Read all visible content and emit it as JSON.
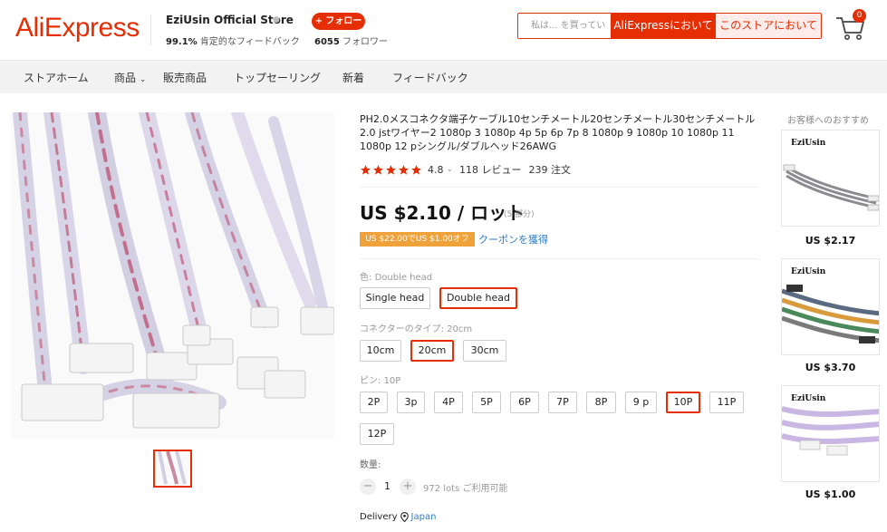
{
  "header": {
    "logo": "AliExpress",
    "store_name": "EziUsin Official Store",
    "store_rating_value": "99.1%",
    "store_rating_text": "肯定的なフィードバック",
    "follow_label": "+ フォロー",
    "followers_count": "6055",
    "followers_label": "フォロワー",
    "search_placeholder": "私は... を買ってい",
    "search_aliexpress": "AliExpressにおいて",
    "search_store": "このストアにおいて",
    "cart_count": "0"
  },
  "nav": {
    "items": [
      "ストアホーム",
      "商品",
      "販売商品",
      "トップセーリング",
      "新着",
      "フィードバック"
    ]
  },
  "product": {
    "title": "PH2.0メスコネクタ端子ケーブル10センチメートル20センチメートル30センチメートル 2.0 jstワイヤー2 1080p 3 1080p 4p 5p 6p 7p 8 1080p 9 1080p 10 1080p 11 1080p 12 pシングル/ダブルヘッド26AWG",
    "rating": "4.8",
    "reviews": "118 レビュー",
    "orders": "239 注文",
    "price": "US $2.10 / ロット",
    "price_sub": "(5 部分)",
    "coupon": "US $22.00でUS $1.00オフ",
    "coupon_link": "クーポンを獲得",
    "color_label": "色:",
    "color_value": "Double head",
    "color_options": [
      "Single head",
      "Double head"
    ],
    "connector_label": "コネクターのタイプ:",
    "connector_value": "20cm",
    "connector_options": [
      "10cm",
      "20cm",
      "30cm"
    ],
    "pin_label": "ピン:",
    "pin_value": "10P",
    "pin_options": [
      "2P",
      "3p",
      "4P",
      "5P",
      "6P",
      "7P",
      "8P",
      "9 p",
      "10P",
      "11P",
      "12P"
    ],
    "quantity_label": "数量:",
    "quantity": "1",
    "available": "972 lots ご利用可能",
    "delivery_label": "Delivery",
    "delivery_location": "Japan"
  },
  "recommendations": {
    "title": "お客様へのおすすめ",
    "items": [
      {
        "brand": "EziUsin",
        "price": "US $2.17"
      },
      {
        "brand": "EziUsin",
        "price": "US $3.70"
      },
      {
        "brand": "EziUsin",
        "price": "US $1.00"
      }
    ]
  },
  "colors": {
    "accent": "#e62e04",
    "coupon": "#f0a23a",
    "link": "#2e7bc6"
  }
}
